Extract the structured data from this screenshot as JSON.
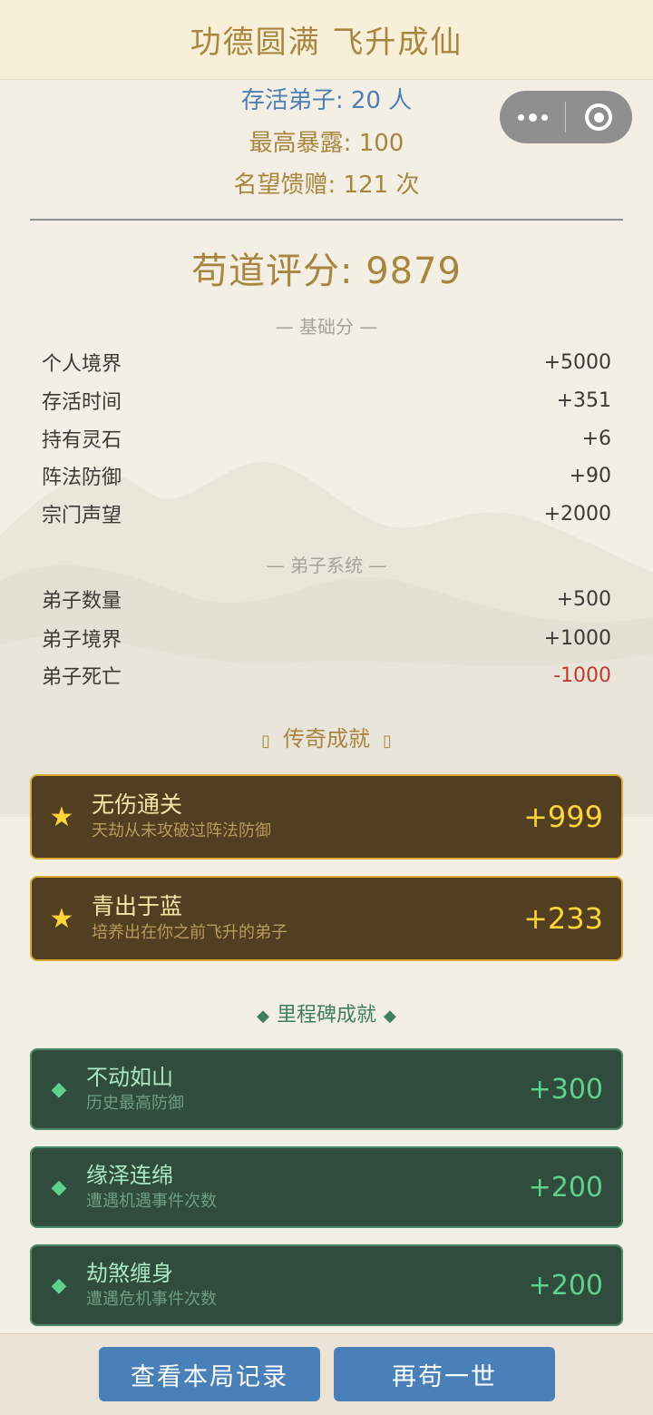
{
  "header": {
    "title": "功德圆满 飞升成仙"
  },
  "stats": {
    "disciples_alive": "存活弟子: 20 人",
    "max_exposure": "最高暴露: 100",
    "fame_gifts": "名望馈赠: 121 次"
  },
  "score": {
    "label": "苟道评分: 9879",
    "value": 9879
  },
  "base_section": {
    "title": "— 基础分 —",
    "items": [
      {
        "label": "个人境界",
        "value": "+5000"
      },
      {
        "label": "存活时间",
        "value": "+351"
      },
      {
        "label": "持有灵石",
        "value": "+6"
      },
      {
        "label": "阵法防御",
        "value": "+90"
      },
      {
        "label": "宗门声望",
        "value": "+2000"
      }
    ]
  },
  "disciple_section": {
    "title": "— 弟子系统 —",
    "items": [
      {
        "label": "弟子数量",
        "value": "+500"
      },
      {
        "label": "弟子境界",
        "value": "+1000"
      },
      {
        "label": "弟子死亡",
        "value": "-1000"
      }
    ]
  },
  "legendary": {
    "title": "传奇成就",
    "box_glyph": "▯",
    "cards": [
      {
        "name": "无伤通关",
        "desc": "天劫从未攻破过阵法防御",
        "points": "+999"
      },
      {
        "name": "青出于蓝",
        "desc": "培养出在你之前飞升的弟子",
        "points": "+233"
      }
    ]
  },
  "milestones": {
    "title": "里程碑成就",
    "diamond_glyph": "◆",
    "cards": [
      {
        "name": "不动如山",
        "desc": "历史最高防御",
        "points": "+300"
      },
      {
        "name": "缘泽连绵",
        "desc": "遭遇机遇事件次数",
        "points": "+200"
      },
      {
        "name": "劫煞缠身",
        "desc": "遭遇危机事件次数",
        "points": "+200"
      }
    ]
  },
  "footer": {
    "view_record_label": "查看本局记录",
    "replay_label": "再苟一世"
  },
  "icons": {
    "star": "★",
    "more": "more-dots-icon",
    "close": "target-close-icon"
  },
  "colors": {
    "gold": "#a8863f",
    "blue": "#4f7fb3",
    "legend_bg": "#523e20",
    "legend_border": "#d9a93a",
    "milestone_bg": "#2f4c3c",
    "milestone_accent": "#5fd18e",
    "negative": "#c23a2b",
    "button": "#4a80b8"
  }
}
